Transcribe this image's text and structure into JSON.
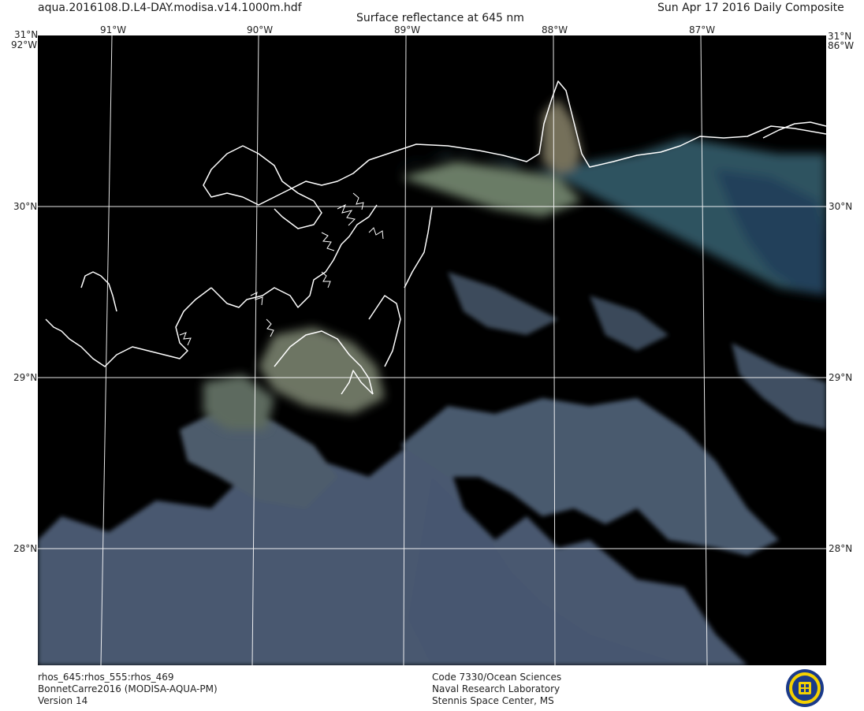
{
  "header": {
    "filename": "aqua.2016108.D.L4-DAY.modisa.v14.1000m.hdf",
    "product": "Surface reflectance at 645 nm",
    "date": "Sun Apr 17 2016 Daily Composite"
  },
  "map": {
    "lat_labels": [
      "31°N",
      "30°N",
      "29°N",
      "28°N"
    ],
    "lon_labels": [
      "91°W",
      "90°W",
      "89°W",
      "88°W",
      "87°W"
    ],
    "corner_labels": [
      "31°N",
      "31°N",
      "92°W",
      "86°W"
    ],
    "lat_range": [
      27.3,
      31.0
    ],
    "lon_range": [
      -91.5,
      -86.25
    ],
    "background_color": "#000000",
    "grid_color": "#ffffff",
    "coastline_color": "#ffffff"
  },
  "footer": {
    "left": [
      "rhos_645:rhos_555:rhos_469",
      "BonnetCarre2016 (MODISA-AQUA-PM)",
      "Version 14"
    ],
    "right": [
      "Code 7330/Ocean Sciences",
      "Naval Research Laboratory",
      "Stennis Space Center, MS"
    ]
  },
  "logo": {
    "icon": "nrl-seal-icon"
  }
}
